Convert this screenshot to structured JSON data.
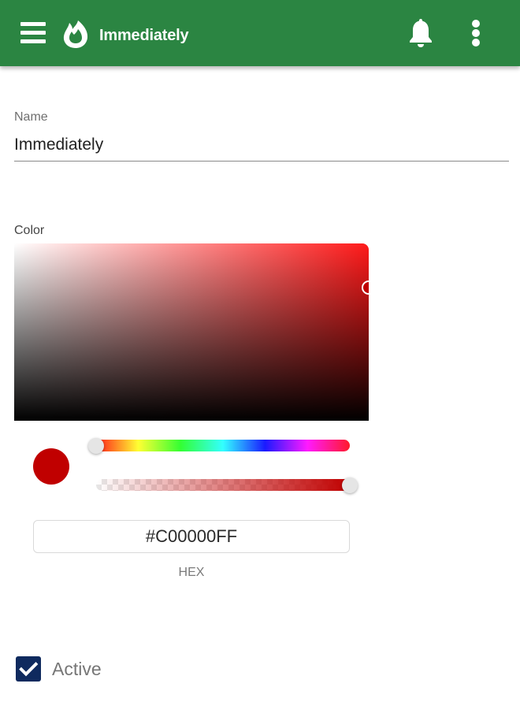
{
  "appbar": {
    "title": "Immediately",
    "icons": {
      "menu": "hamburger-menu-icon",
      "logo": "fire-icon",
      "notifications": "bell-icon",
      "more": "more-vert-icon"
    },
    "background_color": "#2b8542"
  },
  "form": {
    "name_label": "Name",
    "name_value": "Immediately",
    "color_label": "Color",
    "color_picker": {
      "hue_degrees": 0,
      "saturation": 1.0,
      "value": 0.75,
      "alpha": 1.0,
      "selected_color": "#C00000",
      "hex_value": "#C00000FF",
      "hex_label": "HEX"
    },
    "active_label": "Active",
    "active_checked": true,
    "checkbox_color": "#0f2a5e"
  }
}
